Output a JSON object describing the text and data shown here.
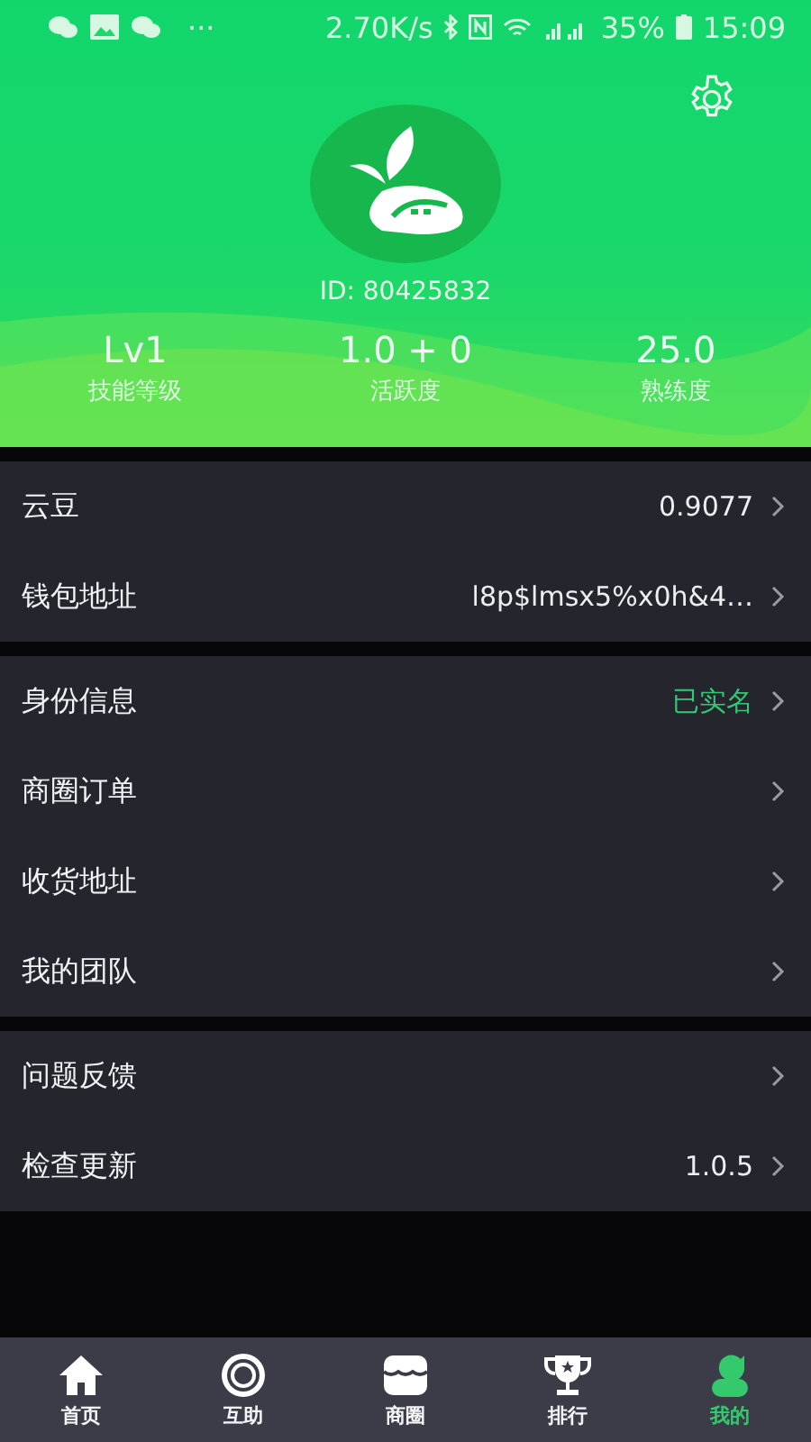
{
  "status_bar": {
    "more": "···",
    "speed": "2.70K/s",
    "battery": "35%",
    "time": "15:09"
  },
  "profile": {
    "id": "ID: 80425832",
    "stats": [
      {
        "value": "Lv1",
        "label": "技能等级"
      },
      {
        "value": "1.0 + 0",
        "label": "活跃度"
      },
      {
        "value": "25.0",
        "label": "熟练度"
      }
    ]
  },
  "groups": [
    [
      {
        "label": "云豆",
        "value": "0.9077",
        "highlight": false
      },
      {
        "label": "钱包地址",
        "value": "l8p$lmsx5%x0h&4…",
        "highlight": false
      }
    ],
    [
      {
        "label": "身份信息",
        "value": "已实名",
        "highlight": true
      },
      {
        "label": "商圈订单"
      },
      {
        "label": "收货地址"
      },
      {
        "label": "我的团队"
      }
    ],
    [
      {
        "label": "问题反馈"
      },
      {
        "label": "检查更新",
        "value": "1.0.5",
        "highlight": false
      }
    ]
  ],
  "tab_bar": [
    {
      "kind": "home",
      "label": "首页",
      "selected": false
    },
    {
      "kind": "rings",
      "label": "互助",
      "selected": false
    },
    {
      "kind": "store",
      "label": "商圈",
      "selected": false
    },
    {
      "kind": "trophy",
      "label": "排行",
      "selected": false
    },
    {
      "kind": "person",
      "label": "我的",
      "selected": true
    }
  ]
}
